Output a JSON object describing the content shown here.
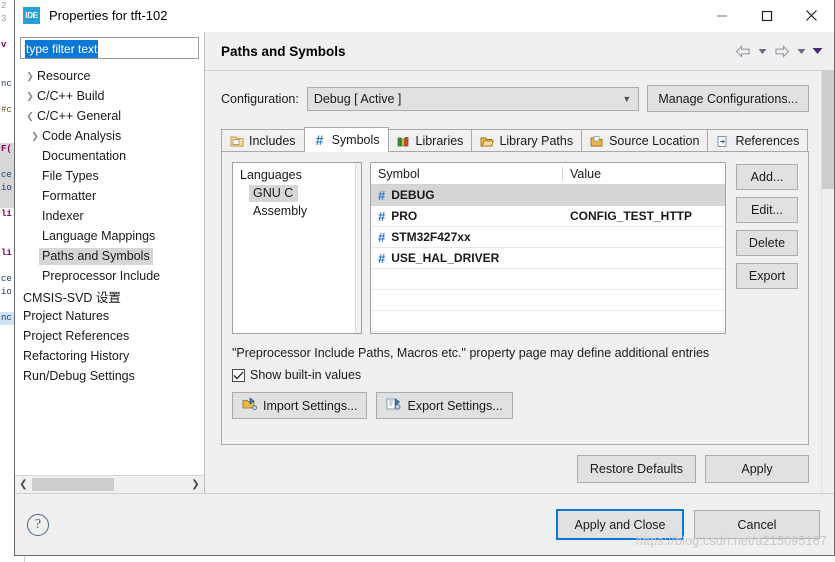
{
  "window": {
    "icon": "ide-icon",
    "icon_text": "IDE",
    "title": "Properties for tft-102",
    "controls": {
      "minimize": "minimize-icon",
      "maximize": "maximize-icon",
      "close": "close-icon"
    }
  },
  "sidebar": {
    "filter": {
      "value": "type filter text",
      "placeholder": "type filter text",
      "selected": true
    },
    "items": [
      {
        "label": "Resource",
        "level": 0,
        "arrow": "collapsed",
        "selected": false
      },
      {
        "label": "C/C++ Build",
        "level": 0,
        "arrow": "collapsed",
        "selected": false
      },
      {
        "label": "C/C++ General",
        "level": 0,
        "arrow": "expanded",
        "selected": false
      },
      {
        "label": "Code Analysis",
        "level": 1,
        "arrow": "collapsed",
        "selected": false
      },
      {
        "label": "Documentation",
        "level": 1,
        "arrow": "none",
        "selected": false
      },
      {
        "label": "File Types",
        "level": 1,
        "arrow": "none",
        "selected": false
      },
      {
        "label": "Formatter",
        "level": 1,
        "arrow": "none",
        "selected": false
      },
      {
        "label": "Indexer",
        "level": 1,
        "arrow": "none",
        "selected": false
      },
      {
        "label": "Language Mappings",
        "level": 1,
        "arrow": "none",
        "selected": false
      },
      {
        "label": "Paths and Symbols",
        "level": 1,
        "arrow": "none",
        "selected": true
      },
      {
        "label": "Preprocessor Include",
        "level": 1,
        "arrow": "none",
        "selected": false
      },
      {
        "label": "CMSIS-SVD 设置",
        "level": 0,
        "arrow": "none",
        "selected": false
      },
      {
        "label": "Project Natures",
        "level": 0,
        "arrow": "none",
        "selected": false
      },
      {
        "label": "Project References",
        "level": 0,
        "arrow": "none",
        "selected": false
      },
      {
        "label": "Refactoring History",
        "level": 0,
        "arrow": "none",
        "selected": false
      },
      {
        "label": "Run/Debug Settings",
        "level": 0,
        "arrow": "none",
        "selected": false
      }
    ],
    "scrollbar": {
      "left_arrow": "chevron-left-icon",
      "right_arrow": "chevron-right-icon"
    }
  },
  "pane": {
    "title": "Paths and Symbols",
    "nav": {
      "back": "back-arrow-icon",
      "back_menu": "chevron-down-icon",
      "forward": "forward-arrow-icon",
      "forward_menu": "chevron-down-icon",
      "view_menu": "view-menu-icon"
    },
    "configuration": {
      "label": "Configuration:",
      "value": "Debug  [ Active ]",
      "caret": "chevron-down-icon",
      "manage_label": "Manage Configurations..."
    },
    "tabs": [
      {
        "label": "Includes",
        "icon": "includes-folder-icon",
        "active": false
      },
      {
        "label": "Symbols",
        "icon": "hash-icon",
        "active": true
      },
      {
        "label": "Libraries",
        "icon": "books-icon",
        "active": false
      },
      {
        "label": "Library Paths",
        "icon": "folder-open-icon",
        "active": false
      },
      {
        "label": "Source Location",
        "icon": "source-folder-icon",
        "active": false
      },
      {
        "label": "References",
        "icon": "references-icon",
        "active": false
      }
    ],
    "languages": {
      "header": "Languages",
      "items": [
        {
          "label": "GNU C",
          "selected": true
        },
        {
          "label": "Assembly",
          "selected": false
        }
      ]
    },
    "symbols_table": {
      "columns": [
        "Symbol",
        "Value"
      ],
      "rows": [
        {
          "symbol": "DEBUG",
          "value": "",
          "selected": true
        },
        {
          "symbol": "PRO",
          "value": "CONFIG_TEST_HTTP",
          "selected": false
        },
        {
          "symbol": "STM32F427xx",
          "value": "",
          "selected": false
        },
        {
          "symbol": "USE_HAL_DRIVER",
          "value": "",
          "selected": false
        },
        {
          "symbol": "",
          "value": "",
          "selected": false
        },
        {
          "symbol": "",
          "value": "",
          "selected": false
        },
        {
          "symbol": "",
          "value": "",
          "selected": false
        }
      ],
      "hash_glyph": "#"
    },
    "side_buttons": [
      {
        "label": "Add...",
        "name": "add-button"
      },
      {
        "label": "Edit...",
        "name": "edit-button"
      },
      {
        "label": "Delete",
        "name": "delete-button"
      },
      {
        "label": "Export",
        "name": "export-button"
      }
    ],
    "note": "\"Preprocessor Include Paths, Macros etc.\" property page may define additional entries",
    "show_builtin": {
      "label": "Show built-in values",
      "checked": true,
      "check_glyph": "✓"
    },
    "settings_buttons": [
      {
        "label": "Import Settings...",
        "icon": "import-settings-icon",
        "name": "import-settings-button"
      },
      {
        "label": "Export Settings...",
        "icon": "export-settings-icon",
        "name": "export-settings-button"
      }
    ],
    "bottom_buttons": [
      {
        "label": "Restore Defaults",
        "name": "restore-defaults-button"
      },
      {
        "label": "Apply",
        "name": "apply-button"
      }
    ]
  },
  "footer": {
    "help": "help-icon",
    "help_glyph": "?",
    "buttons": [
      {
        "label": "Apply and Close",
        "name": "apply-and-close-button",
        "default": true
      },
      {
        "label": "Cancel",
        "name": "cancel-button",
        "default": false
      }
    ]
  },
  "watermark": "https://blog.csdn.net/a215095167",
  "editor_backdrop": {
    "lines": [
      "2",
      "3",
      "v",
      "nc",
      "#c",
      "F(",
      "ce",
      "io",
      "li",
      "li",
      "ce",
      "io",
      "nc"
    ]
  },
  "colors": {
    "accent": "#0a78d7",
    "hash": "#2f73c8",
    "selection": "#d6d6d6",
    "panel": "#f0f0f0",
    "button": "#e1e1e1"
  }
}
